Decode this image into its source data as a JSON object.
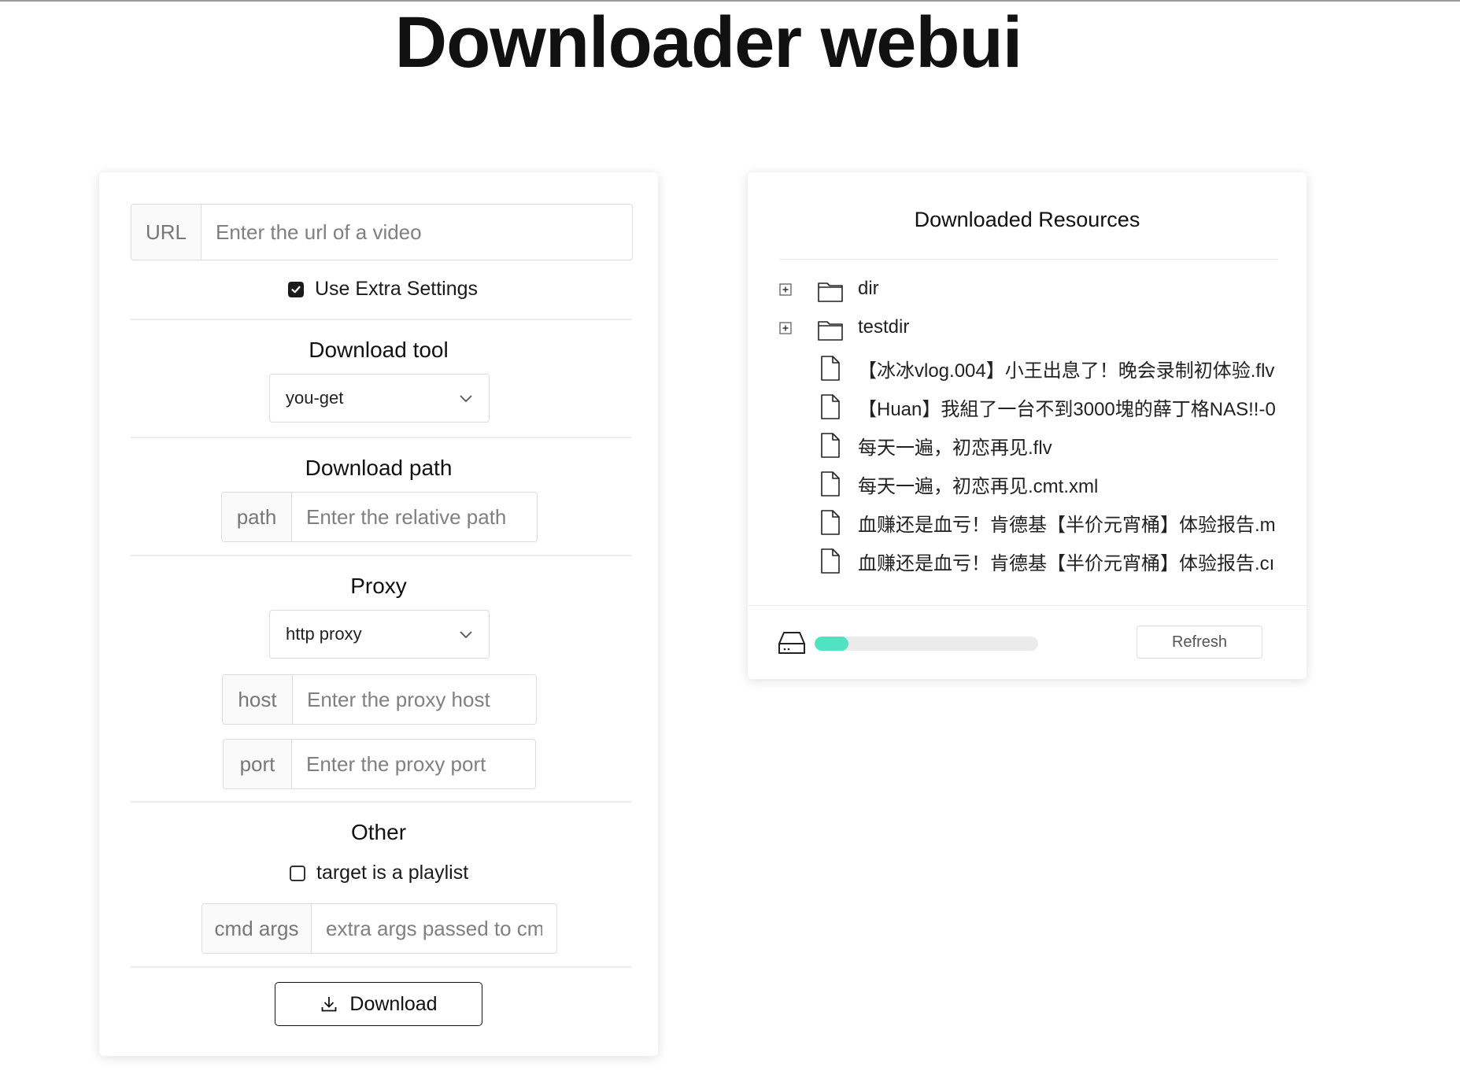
{
  "page": {
    "title": "Downloader webui"
  },
  "form": {
    "url": {
      "addon": "URL",
      "placeholder": "Enter the url of a video"
    },
    "use_extra_settings": {
      "label": "Use Extra Settings",
      "checked": true
    },
    "download_tool": {
      "title": "Download tool",
      "selected": "you-get"
    },
    "download_path": {
      "title": "Download path",
      "addon": "path",
      "placeholder": "Enter the relative path"
    },
    "proxy": {
      "title": "Proxy",
      "selected": "http proxy",
      "host": {
        "addon": "host",
        "placeholder": "Enter the proxy host"
      },
      "port": {
        "addon": "port",
        "placeholder": "Enter the proxy port"
      }
    },
    "other": {
      "title": "Other",
      "playlist": {
        "label": "target is a playlist",
        "checked": false
      },
      "cmd_args": {
        "addon": "cmd args",
        "placeholder": "extra args passed to cmd"
      }
    },
    "download_button": {
      "label": "Download",
      "icon": "download-icon"
    }
  },
  "resources": {
    "title": "Downloaded Resources",
    "items": [
      {
        "type": "folder",
        "name": "dir",
        "icon": "folder-icon",
        "expander": "plus-square-icon"
      },
      {
        "type": "folder",
        "name": "testdir",
        "icon": "folder-icon",
        "expander": "plus-square-icon"
      },
      {
        "type": "file",
        "name": "【冰冰vlog.004】小王出息了！晚会录制初体验.flv",
        "icon": "file-icon"
      },
      {
        "type": "file",
        "name": "【Huan】我組了一台不到3000塊的薛丁格NAS!!-0",
        "icon": "file-icon"
      },
      {
        "type": "file",
        "name": "每天一遍，初恋再见.flv",
        "icon": "file-icon"
      },
      {
        "type": "file",
        "name": "每天一遍，初恋再见.cmt.xml",
        "icon": "file-icon"
      },
      {
        "type": "file",
        "name": "血赚还是血亏！肯德基【半价元宵桶】体验报告.m",
        "icon": "file-icon"
      },
      {
        "type": "file",
        "name": "血赚还是血亏！肯德基【半价元宵桶】体验报告.cı",
        "icon": "file-icon"
      }
    ],
    "disk_usage_fraction": 0.15,
    "disk_icon": "hard-drive-icon",
    "refresh_label": "Refresh"
  },
  "colors": {
    "progress_fill": "#4fe3c1",
    "progress_track": "#ebebeb",
    "border": "#dcdcdc"
  }
}
